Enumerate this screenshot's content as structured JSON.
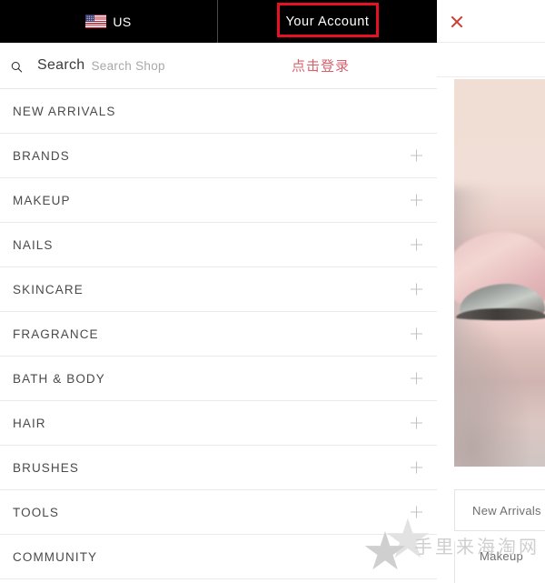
{
  "topbar": {
    "locale": {
      "icon": "us-flag-icon",
      "label": "US"
    },
    "account": {
      "label": "Your Account"
    },
    "annotation_color": "#e81123"
  },
  "search": {
    "icon": "search-icon",
    "label": "Search",
    "placeholder": "Search Shop",
    "login_link": "点击登录",
    "login_link_color": "#d4626b"
  },
  "nav": {
    "items": [
      {
        "label": "NEW ARRIVALS",
        "expandable": false
      },
      {
        "label": "BRANDS",
        "expandable": true
      },
      {
        "label": "MAKEUP",
        "expandable": true
      },
      {
        "label": "NAILS",
        "expandable": true
      },
      {
        "label": "SKINCARE",
        "expandable": true
      },
      {
        "label": "FRAGRANCE",
        "expandable": true
      },
      {
        "label": "BATH & BODY",
        "expandable": true
      },
      {
        "label": "HAIR",
        "expandable": true
      },
      {
        "label": "BRUSHES",
        "expandable": true
      },
      {
        "label": "TOOLS",
        "expandable": true
      },
      {
        "label": "COMMUNITY",
        "expandable": false
      }
    ]
  },
  "right_panel": {
    "close_icon": "close-icon",
    "close_icon_color": "#cc3d33",
    "hero_image_alt": "eye-closeup-with-pink-shimmer-eyeshadow",
    "card_new_arrivals": "New Arrivals",
    "card_makeup": "Makeup"
  },
  "watermark": {
    "text": "手里来海淘网",
    "star_glyph": "★",
    "color": "#cfcfcf"
  }
}
